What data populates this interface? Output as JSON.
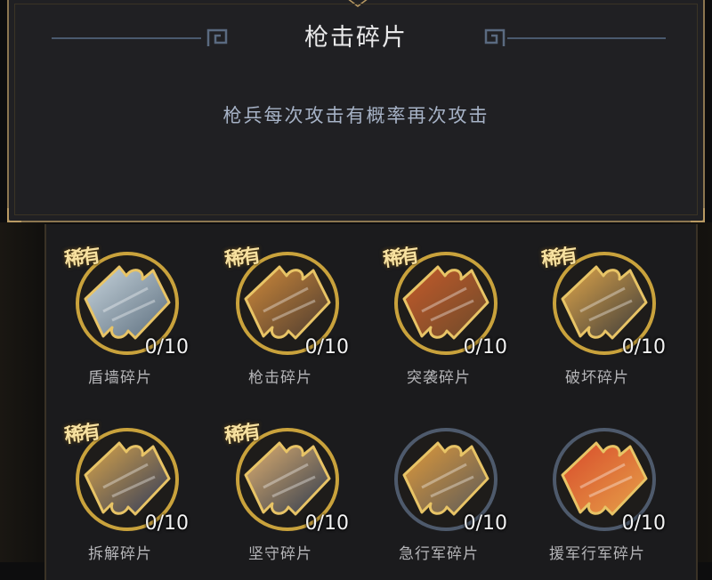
{
  "panel": {
    "title": "枪击碎片",
    "description": "枪兵每次攻击有概率再次攻击"
  },
  "fragments": [
    {
      "name": "盾墙碎片",
      "count": "0/10",
      "rare": true,
      "rare_label": "稀有",
      "icon": "shield-wall-art-icon",
      "colors": [
        "#c7d4dc",
        "#5c6e7e"
      ],
      "ring": "#c9a23c"
    },
    {
      "name": "枪击碎片",
      "count": "0/10",
      "rare": true,
      "rare_label": "稀有",
      "icon": "spear-strike-art-icon",
      "colors": [
        "#d08a3a",
        "#4a3a30"
      ],
      "ring": "#c9a23c"
    },
    {
      "name": "突袭碎片",
      "count": "0/10",
      "rare": true,
      "rare_label": "稀有",
      "icon": "raid-art-icon",
      "colors": [
        "#c55a2a",
        "#6c4a2a"
      ],
      "ring": "#c9a23c"
    },
    {
      "name": "破坏碎片",
      "count": "0/10",
      "rare": true,
      "rare_label": "稀有",
      "icon": "destruction-art-icon",
      "colors": [
        "#e0a64a",
        "#3a3a3a"
      ],
      "ring": "#c9a23c"
    },
    {
      "name": "拆解碎片",
      "count": "0/10",
      "rare": true,
      "rare_label": "稀有",
      "icon": "dismantle-art-icon",
      "colors": [
        "#d9a54a",
        "#2f3a5a"
      ],
      "ring": "#c9a23c"
    },
    {
      "name": "坚守碎片",
      "count": "0/10",
      "rare": true,
      "rare_label": "稀有",
      "icon": "hold-fast-art-icon",
      "colors": [
        "#e0b070",
        "#2e3a4e"
      ],
      "ring": "#c9a23c"
    },
    {
      "name": "急行军碎片",
      "count": "0/10",
      "rare": false,
      "rare_label": "",
      "icon": "forced-march-art-icon",
      "colors": [
        "#e09a3a",
        "#5a5a5a"
      ],
      "ring": "#4e5a6c"
    },
    {
      "name": "援军行军碎片",
      "count": "0/10",
      "rare": false,
      "rare_label": "",
      "icon": "reinforcement-march-art-icon",
      "colors": [
        "#d84a2a",
        "#e6a24a"
      ],
      "ring": "#4e5a6c"
    }
  ]
}
